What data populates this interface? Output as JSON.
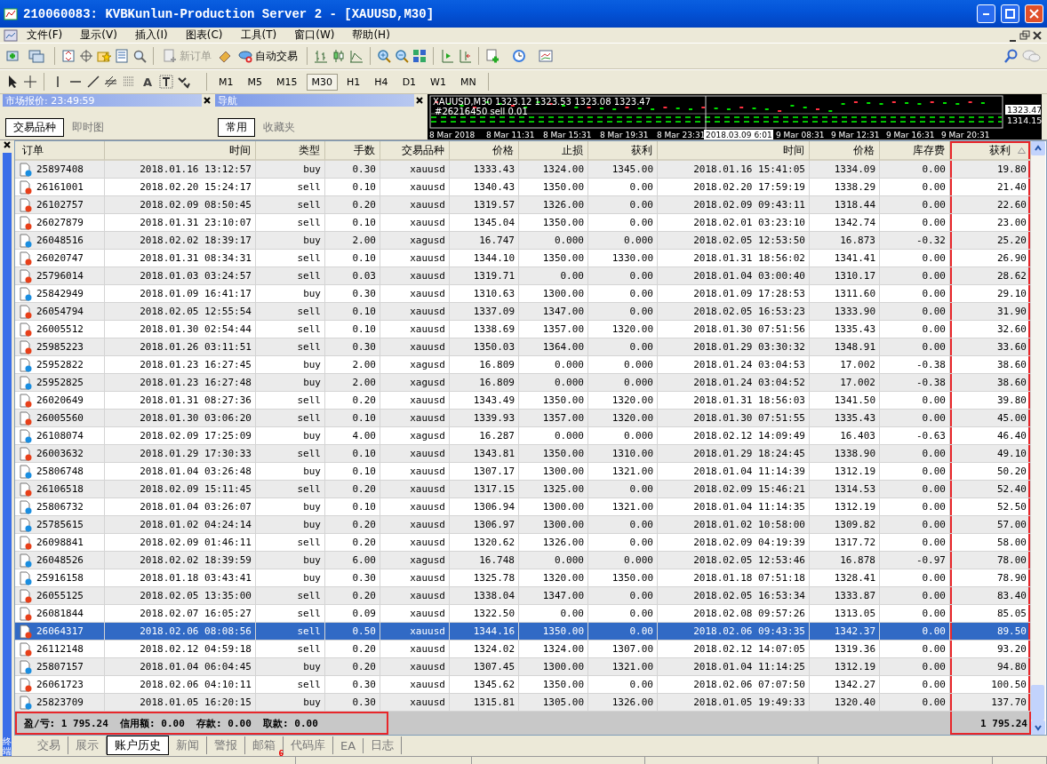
{
  "window": {
    "title": "210060083: KVBKunlun-Production Server 2 - [XAUUSD,M30]"
  },
  "menu": [
    "文件(F)",
    "显示(V)",
    "插入(I)",
    "图表(C)",
    "工具(T)",
    "窗口(W)",
    "帮助(H)"
  ],
  "toolbar": {
    "new_order": {
      "label": "新订单",
      "disabled": true
    },
    "auto_trading": {
      "label": "自动交易",
      "disabled": false
    },
    "text_tool": "A"
  },
  "timeframes": [
    {
      "label": "M1",
      "selected": false
    },
    {
      "label": "M5",
      "selected": false
    },
    {
      "label": "M15",
      "selected": false
    },
    {
      "label": "M30",
      "selected": true
    },
    {
      "label": "H1",
      "selected": false
    },
    {
      "label": "H4",
      "selected": false
    },
    {
      "label": "D1",
      "selected": false
    },
    {
      "label": "W1",
      "selected": false
    },
    {
      "label": "MN",
      "selected": false
    }
  ],
  "market_watch": {
    "title": "市场报价: 23:49:59",
    "tabs": [
      {
        "label": "交易品种",
        "selected": true
      },
      {
        "label": "即时图",
        "selected": false
      }
    ]
  },
  "navigator": {
    "title": "导航",
    "tabs": [
      {
        "label": "常用",
        "selected": true
      },
      {
        "label": "收藏夹",
        "selected": false
      }
    ]
  },
  "chart": {
    "header": "XAUUSD,M30  1323.12 1323.53 1323.08 1323.47",
    "order_label": "#26216450 sell 0.01",
    "prices": [
      "1323.47",
      "1314.15"
    ],
    "times": [
      {
        "label": "8 Mar 2018",
        "kind": "tick"
      },
      {
        "label": "8 Mar 11:31",
        "kind": "tick"
      },
      {
        "label": "8 Mar 15:31",
        "kind": "tick"
      },
      {
        "label": "8 Mar 19:31",
        "kind": "tick"
      },
      {
        "label": "8 Mar 23:31",
        "kind": "tick"
      },
      {
        "label": "2018.03.09 6:01",
        "kind": "cursor"
      },
      {
        "label": "9 Mar 08:31",
        "kind": "tick"
      },
      {
        "label": "9 Mar 12:31",
        "kind": "tick"
      },
      {
        "label": "9 Mar 16:31",
        "kind": "tick"
      },
      {
        "label": "9 Mar 20:31",
        "kind": "tick"
      }
    ]
  },
  "table": {
    "columns": [
      {
        "label": "订单",
        "highlighted": false,
        "sorted": false
      },
      {
        "label": "时间",
        "highlighted": false,
        "sorted": false
      },
      {
        "label": "类型",
        "highlighted": false,
        "sorted": false
      },
      {
        "label": "手数",
        "highlighted": false,
        "sorted": false
      },
      {
        "label": "交易品种",
        "highlighted": false,
        "sorted": false
      },
      {
        "label": "价格",
        "highlighted": false,
        "sorted": false
      },
      {
        "label": "止损",
        "highlighted": false,
        "sorted": false
      },
      {
        "label": "获利",
        "highlighted": false,
        "sorted": false
      },
      {
        "label": "时间",
        "highlighted": false,
        "sorted": false
      },
      {
        "label": "价格",
        "highlighted": false,
        "sorted": false
      },
      {
        "label": "库存费",
        "highlighted": false,
        "sorted": false
      },
      {
        "label": "获利",
        "highlighted": true,
        "sorted": true
      }
    ],
    "rows": [
      {
        "selected": false,
        "kind": "buy",
        "cells": [
          "25897408",
          "2018.01.16 13:12:57",
          "buy",
          "0.30",
          "xauusd",
          "1333.43",
          "1324.00",
          "1345.00",
          "2018.01.16 15:41:05",
          "1334.09",
          "0.00",
          "19.80"
        ]
      },
      {
        "selected": false,
        "kind": "sell",
        "cells": [
          "26161001",
          "2018.02.20 15:24:17",
          "sell",
          "0.10",
          "xauusd",
          "1340.43",
          "1350.00",
          "0.00",
          "2018.02.20 17:59:19",
          "1338.29",
          "0.00",
          "21.40"
        ]
      },
      {
        "selected": false,
        "kind": "sell",
        "cells": [
          "26102757",
          "2018.02.09 08:50:45",
          "sell",
          "0.20",
          "xauusd",
          "1319.57",
          "1326.00",
          "0.00",
          "2018.02.09 09:43:11",
          "1318.44",
          "0.00",
          "22.60"
        ]
      },
      {
        "selected": false,
        "kind": "sell",
        "cells": [
          "26027879",
          "2018.01.31 23:10:07",
          "sell",
          "0.10",
          "xauusd",
          "1345.04",
          "1350.00",
          "0.00",
          "2018.02.01 03:23:10",
          "1342.74",
          "0.00",
          "23.00"
        ]
      },
      {
        "selected": false,
        "kind": "buy",
        "cells": [
          "26048516",
          "2018.02.02 18:39:17",
          "buy",
          "2.00",
          "xagusd",
          "16.747",
          "0.000",
          "0.000",
          "2018.02.05 12:53:50",
          "16.873",
          "-0.32",
          "25.20"
        ]
      },
      {
        "selected": false,
        "kind": "sell",
        "cells": [
          "26020747",
          "2018.01.31 08:34:31",
          "sell",
          "0.10",
          "xauusd",
          "1344.10",
          "1350.00",
          "1330.00",
          "2018.01.31 18:56:02",
          "1341.41",
          "0.00",
          "26.90"
        ]
      },
      {
        "selected": false,
        "kind": "sell",
        "cells": [
          "25796014",
          "2018.01.03 03:24:57",
          "sell",
          "0.03",
          "xauusd",
          "1319.71",
          "0.00",
          "0.00",
          "2018.01.04 03:00:40",
          "1310.17",
          "0.00",
          "28.62"
        ]
      },
      {
        "selected": false,
        "kind": "buy",
        "cells": [
          "25842949",
          "2018.01.09 16:41:17",
          "buy",
          "0.30",
          "xauusd",
          "1310.63",
          "1300.00",
          "0.00",
          "2018.01.09 17:28:53",
          "1311.60",
          "0.00",
          "29.10"
        ]
      },
      {
        "selected": false,
        "kind": "sell",
        "cells": [
          "26054794",
          "2018.02.05 12:55:54",
          "sell",
          "0.10",
          "xauusd",
          "1337.09",
          "1347.00",
          "0.00",
          "2018.02.05 16:53:23",
          "1333.90",
          "0.00",
          "31.90"
        ]
      },
      {
        "selected": false,
        "kind": "sell",
        "cells": [
          "26005512",
          "2018.01.30 02:54:44",
          "sell",
          "0.10",
          "xauusd",
          "1338.69",
          "1357.00",
          "1320.00",
          "2018.01.30 07:51:56",
          "1335.43",
          "0.00",
          "32.60"
        ]
      },
      {
        "selected": false,
        "kind": "sell",
        "cells": [
          "25985223",
          "2018.01.26 03:11:51",
          "sell",
          "0.30",
          "xauusd",
          "1350.03",
          "1364.00",
          "0.00",
          "2018.01.29 03:30:32",
          "1348.91",
          "0.00",
          "33.60"
        ]
      },
      {
        "selected": false,
        "kind": "buy",
        "cells": [
          "25952822",
          "2018.01.23 16:27:45",
          "buy",
          "2.00",
          "xagusd",
          "16.809",
          "0.000",
          "0.000",
          "2018.01.24 03:04:53",
          "17.002",
          "-0.38",
          "38.60"
        ]
      },
      {
        "selected": false,
        "kind": "buy",
        "cells": [
          "25952825",
          "2018.01.23 16:27:48",
          "buy",
          "2.00",
          "xagusd",
          "16.809",
          "0.000",
          "0.000",
          "2018.01.24 03:04:52",
          "17.002",
          "-0.38",
          "38.60"
        ]
      },
      {
        "selected": false,
        "kind": "sell",
        "cells": [
          "26020649",
          "2018.01.31 08:27:36",
          "sell",
          "0.20",
          "xauusd",
          "1343.49",
          "1350.00",
          "1320.00",
          "2018.01.31 18:56:03",
          "1341.50",
          "0.00",
          "39.80"
        ]
      },
      {
        "selected": false,
        "kind": "sell",
        "cells": [
          "26005560",
          "2018.01.30 03:06:20",
          "sell",
          "0.10",
          "xauusd",
          "1339.93",
          "1357.00",
          "1320.00",
          "2018.01.30 07:51:55",
          "1335.43",
          "0.00",
          "45.00"
        ]
      },
      {
        "selected": false,
        "kind": "buy",
        "cells": [
          "26108074",
          "2018.02.09 17:25:09",
          "buy",
          "4.00",
          "xagusd",
          "16.287",
          "0.000",
          "0.000",
          "2018.02.12 14:09:49",
          "16.403",
          "-0.63",
          "46.40"
        ]
      },
      {
        "selected": false,
        "kind": "sell",
        "cells": [
          "26003632",
          "2018.01.29 17:30:33",
          "sell",
          "0.10",
          "xauusd",
          "1343.81",
          "1350.00",
          "1310.00",
          "2018.01.29 18:24:45",
          "1338.90",
          "0.00",
          "49.10"
        ]
      },
      {
        "selected": false,
        "kind": "buy",
        "cells": [
          "25806748",
          "2018.01.04 03:26:48",
          "buy",
          "0.10",
          "xauusd",
          "1307.17",
          "1300.00",
          "1321.00",
          "2018.01.04 11:14:39",
          "1312.19",
          "0.00",
          "50.20"
        ]
      },
      {
        "selected": false,
        "kind": "sell",
        "cells": [
          "26106518",
          "2018.02.09 15:11:45",
          "sell",
          "0.20",
          "xauusd",
          "1317.15",
          "1325.00",
          "0.00",
          "2018.02.09 15:46:21",
          "1314.53",
          "0.00",
          "52.40"
        ]
      },
      {
        "selected": false,
        "kind": "buy",
        "cells": [
          "25806732",
          "2018.01.04 03:26:07",
          "buy",
          "0.10",
          "xauusd",
          "1306.94",
          "1300.00",
          "1321.00",
          "2018.01.04 11:14:35",
          "1312.19",
          "0.00",
          "52.50"
        ]
      },
      {
        "selected": false,
        "kind": "buy",
        "cells": [
          "25785615",
          "2018.01.02 04:24:14",
          "buy",
          "0.20",
          "xauusd",
          "1306.97",
          "1300.00",
          "0.00",
          "2018.01.02 10:58:00",
          "1309.82",
          "0.00",
          "57.00"
        ]
      },
      {
        "selected": false,
        "kind": "sell",
        "cells": [
          "26098841",
          "2018.02.09 01:46:11",
          "sell",
          "0.20",
          "xauusd",
          "1320.62",
          "1326.00",
          "0.00",
          "2018.02.09 04:19:39",
          "1317.72",
          "0.00",
          "58.00"
        ]
      },
      {
        "selected": false,
        "kind": "buy",
        "cells": [
          "26048526",
          "2018.02.02 18:39:59",
          "buy",
          "6.00",
          "xagusd",
          "16.748",
          "0.000",
          "0.000",
          "2018.02.05 12:53:46",
          "16.878",
          "-0.97",
          "78.00"
        ]
      },
      {
        "selected": false,
        "kind": "buy",
        "cells": [
          "25916158",
          "2018.01.18 03:43:41",
          "buy",
          "0.30",
          "xauusd",
          "1325.78",
          "1320.00",
          "1350.00",
          "2018.01.18 07:51:18",
          "1328.41",
          "0.00",
          "78.90"
        ]
      },
      {
        "selected": false,
        "kind": "sell",
        "cells": [
          "26055125",
          "2018.02.05 13:35:00",
          "sell",
          "0.20",
          "xauusd",
          "1338.04",
          "1347.00",
          "0.00",
          "2018.02.05 16:53:34",
          "1333.87",
          "0.00",
          "83.40"
        ]
      },
      {
        "selected": false,
        "kind": "sell",
        "cells": [
          "26081844",
          "2018.02.07 16:05:27",
          "sell",
          "0.09",
          "xauusd",
          "1322.50",
          "0.00",
          "0.00",
          "2018.02.08 09:57:26",
          "1313.05",
          "0.00",
          "85.05"
        ]
      },
      {
        "selected": true,
        "kind": "sell",
        "cells": [
          "26064317",
          "2018.02.06 08:08:56",
          "sell",
          "0.50",
          "xauusd",
          "1344.16",
          "1350.00",
          "0.00",
          "2018.02.06 09:43:35",
          "1342.37",
          "0.00",
          "89.50"
        ]
      },
      {
        "selected": false,
        "kind": "sell",
        "cells": [
          "26112148",
          "2018.02.12 04:59:18",
          "sell",
          "0.20",
          "xauusd",
          "1324.02",
          "1324.00",
          "1307.00",
          "2018.02.12 14:07:05",
          "1319.36",
          "0.00",
          "93.20"
        ]
      },
      {
        "selected": false,
        "kind": "buy",
        "cells": [
          "25807157",
          "2018.01.04 06:04:45",
          "buy",
          "0.20",
          "xauusd",
          "1307.45",
          "1300.00",
          "1321.00",
          "2018.01.04 11:14:25",
          "1312.19",
          "0.00",
          "94.80"
        ]
      },
      {
        "selected": false,
        "kind": "sell",
        "cells": [
          "26061723",
          "2018.02.06 04:10:11",
          "sell",
          "0.30",
          "xauusd",
          "1345.62",
          "1350.00",
          "0.00",
          "2018.02.06 07:07:50",
          "1342.27",
          "0.00",
          "100.50"
        ]
      },
      {
        "selected": false,
        "kind": "buy",
        "cells": [
          "25823709",
          "2018.01.05 16:20:15",
          "buy",
          "0.30",
          "xauusd",
          "1315.81",
          "1305.00",
          "1326.00",
          "2018.01.05 19:49:33",
          "1320.40",
          "0.00",
          "137.70"
        ]
      }
    ],
    "summary": {
      "text": "盈/亏: 1 795.24  信用额: 0.00  存款: 0.00  取款: 0.00",
      "total": "1 795.24",
      "highlighted": true
    }
  },
  "terminal": {
    "label": "终端",
    "tabs": [
      {
        "label": "交易",
        "selected": false
      },
      {
        "label": "展示",
        "selected": false
      },
      {
        "label": "账户历史",
        "selected": true
      },
      {
        "label": "新闻",
        "selected": false
      },
      {
        "label": "警报",
        "selected": false
      },
      {
        "label": "邮箱",
        "selected": false,
        "badge": "6"
      },
      {
        "label": "代码库",
        "selected": false
      },
      {
        "label": "EA",
        "selected": false
      },
      {
        "label": "日志",
        "selected": false
      }
    ]
  }
}
